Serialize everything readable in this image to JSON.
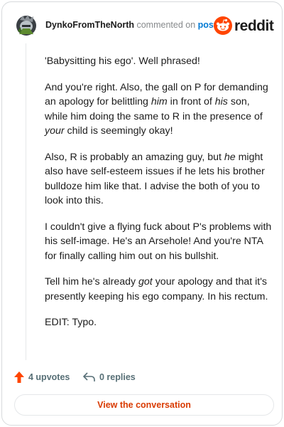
{
  "header": {
    "username": "DynkoFromTheNorth",
    "action_text": "commented on",
    "post_link": "post",
    "brand": "reddit"
  },
  "comment": {
    "paragraphs": [
      [
        {
          "t": "'Babysitting his ego'. Well phrased!"
        }
      ],
      [
        {
          "t": "And you're right. Also, the gall on P for demanding an apology for belittling "
        },
        {
          "t": "him",
          "i": true
        },
        {
          "t": " in front of "
        },
        {
          "t": "his",
          "i": true
        },
        {
          "t": " son, while him doing the same to R in the presence of "
        },
        {
          "t": "your",
          "i": true
        },
        {
          "t": " child is seemingly okay!"
        }
      ],
      [
        {
          "t": "Also, R is probably an amazing guy, but "
        },
        {
          "t": "he",
          "i": true
        },
        {
          "t": " might also have self-esteem issues if he lets his brother bulldoze him like that. I advise the both of you to look into this."
        }
      ],
      [
        {
          "t": "I couldn't give a flying fuck about P's problems with his self-image. He's an Arsehole! And you're NTA for finally calling him out on his bullshit."
        }
      ],
      [
        {
          "t": "Tell him he's already "
        },
        {
          "t": "got",
          "i": true
        },
        {
          "t": " your apology and that it's presently keeping his ego company. In his rectum."
        }
      ],
      [
        {
          "t": "EDIT: Typo."
        }
      ]
    ]
  },
  "actions": {
    "upvotes_label": "4 upvotes",
    "replies_label": "0 replies"
  },
  "footer": {
    "conversation_button": "View the conversation"
  },
  "colors": {
    "accent": "#ff4500",
    "link": "#0079d3",
    "button_text": "#d93a00",
    "muted": "#576f76"
  },
  "icons": [
    "avatar",
    "reddit-logo-icon",
    "upvote-arrow-icon",
    "reply-icon"
  ]
}
